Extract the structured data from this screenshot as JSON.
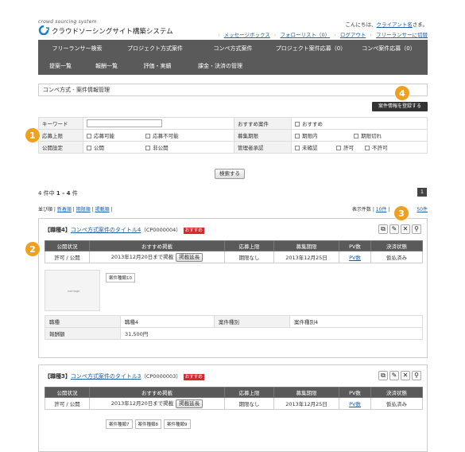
{
  "header": {
    "tagline": "crowd sourcing system",
    "app_title": "クラウドソーシングサイト構築システム",
    "greeting_prefix": "こんにちは、",
    "user_name": "クライアント名",
    "greeting_suffix": "さま。",
    "links": [
      "メッセージボックス",
      "フォローリスト（0）",
      "ログアウト",
      "フリーランサーに切替"
    ]
  },
  "nav": {
    "row1": [
      "フリーランサー検索",
      "プロジェクト方式案件",
      "コンペ方式案件",
      "プロジェクト案件応募（0）",
      "コンペ案件応募（0）"
    ],
    "row2": [
      "提案一覧",
      "報酬一覧",
      "評価・実績",
      "課金・決済の管理"
    ]
  },
  "page": {
    "title": "コンペ方式 - 案件情報管理",
    "register_button": "案件情報を登録する"
  },
  "search": {
    "keyword_label": "キーワード",
    "recommend_label": "おすすめ案件",
    "recommend_opt": "おすすめ",
    "limit_label": "応募上限",
    "limit_opts": [
      "応募可能",
      "応募不可能"
    ],
    "period_label": "募集期限",
    "period_opts": [
      "期限内",
      "期限切れ"
    ],
    "public_label": "公開設定",
    "public_opts": [
      "公開",
      "非公開"
    ],
    "approval_label": "管理者承認",
    "approval_opts": [
      "未確認",
      "許可",
      "不許可"
    ],
    "search_button": "検索する"
  },
  "results": {
    "count_prefix": "4 件中",
    "count_range": "1 - 4",
    "count_suffix": "件",
    "page": "1",
    "sort_label": "並び順",
    "sort_opts": [
      "新着順",
      "期限順",
      "掲載順"
    ],
    "perpage_label": "表示件数",
    "perpage_opts": [
      "10件",
      "50件"
    ]
  },
  "table_headers": [
    "公開状況",
    "おすすめ掲載",
    "応募上限",
    "募集期限",
    "PV数",
    "決済状態"
  ],
  "items": [
    {
      "category": "【職種4】",
      "title": "コンペ方式案件のタイトル4",
      "code": "（CP0000004）",
      "tag": "おすすめ",
      "public": "許可 / 公開",
      "recommend": "2013年12月20日まで掲載",
      "extend": "掲載延長",
      "limit": "期限なし",
      "deadline": "2013年12月25日",
      "pv": "PV数",
      "payment": "仮払済み",
      "thumb_text": "noimage",
      "keywords": [
        "案件種類10"
      ],
      "job_label": "職種",
      "job_value": "職種4",
      "type_label": "案件種別",
      "type_value": "案件種別4",
      "reward_label": "報酬額",
      "reward_value": "31,500円"
    },
    {
      "category": "【職種3】",
      "title": "コンペ方式案件のタイトル3",
      "code": "（CP0000003）",
      "tag": "おすすめ",
      "public": "許可 / 公開",
      "recommend": "2013年12月20日まで掲載",
      "extend": "掲載延長",
      "limit": "期限なし",
      "deadline": "2013年12月25日",
      "pv": "PV数",
      "payment": "仮払済み",
      "keywords": [
        "案件種類7",
        "案件種類8",
        "案件種類9"
      ]
    }
  ],
  "callouts": [
    "1",
    "2",
    "3",
    "4"
  ],
  "colors": {
    "nav_bg": "#5a5a5a",
    "callout": "#f0a020",
    "tag_red": "#d9272d",
    "link": "#1a5fa8"
  }
}
